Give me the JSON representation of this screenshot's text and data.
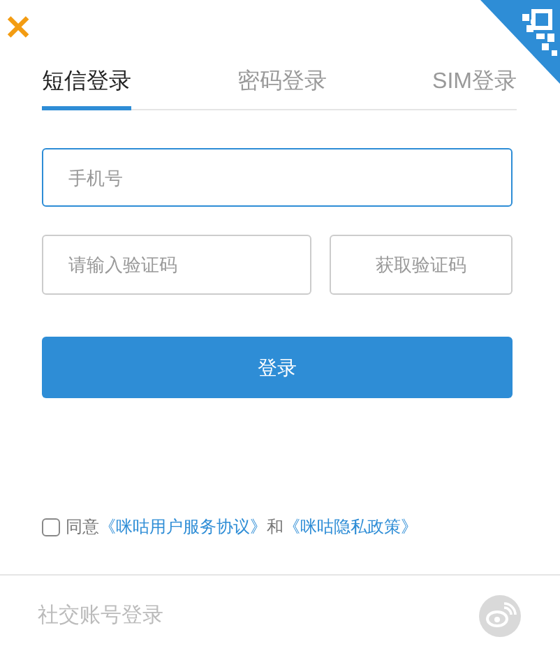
{
  "close_button": {
    "label": "✕"
  },
  "tabs": [
    {
      "label": "短信登录",
      "selected": true
    },
    {
      "label": "密码登录",
      "selected": false
    },
    {
      "label": "SIM登录",
      "selected": false
    }
  ],
  "phone_field": {
    "placeholder": "手机号",
    "focused": true
  },
  "code_field": {
    "placeholder": "请输入验证码"
  },
  "get_code_button": {
    "label": "获取验证码"
  },
  "login_button": {
    "label": "登录"
  },
  "agreement": {
    "checked": false,
    "parts": [
      {
        "kind": "text",
        "text": "同意"
      },
      {
        "kind": "link",
        "text": "《咪咕用户服务协议》"
      },
      {
        "kind": "text",
        "text": "和"
      },
      {
        "kind": "link",
        "text": "《咪咕隐私政策》"
      }
    ]
  },
  "social_login": {
    "label": "社交账号登录"
  }
}
